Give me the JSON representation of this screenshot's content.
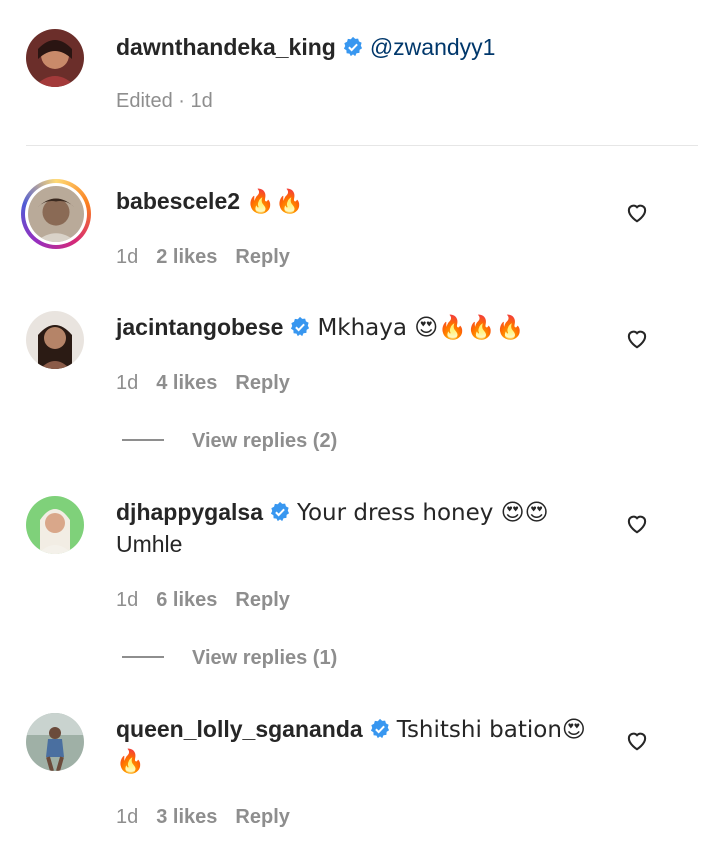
{
  "comments": [
    {
      "username": "dawnthandeka_king",
      "verified": true,
      "text": "@zwandyy1",
      "meta": "Edited · 1d"
    },
    {
      "username": "babescele2",
      "verified": false,
      "text": "🔥🔥",
      "time": "1d",
      "likes": "2 likes",
      "reply": "Reply"
    },
    {
      "username": "jacintangobese",
      "verified": true,
      "text": "Mkhaya 😍🔥🔥🔥",
      "time": "1d",
      "likes": "4 likes",
      "reply": "Reply",
      "view_replies": "View replies (2)"
    },
    {
      "username": "djhappygalsa",
      "verified": true,
      "text": "Your dress honey 😍😍",
      "text2": "Umhle",
      "time": "1d",
      "likes": "6 likes",
      "reply": "Reply",
      "view_replies": "View replies (1)"
    },
    {
      "username": "queen_lolly_sgananda",
      "verified": true,
      "text": "Tshitshi bation😍",
      "text2": "🔥",
      "time": "1d",
      "likes": "3 likes",
      "reply": "Reply"
    }
  ],
  "colors": {
    "verified": "#3897f0",
    "mention": "#00376b",
    "secondary": "#8e8e8e"
  },
  "icons": {
    "heart": "heart-outline-icon",
    "verified": "verified-badge-icon"
  }
}
